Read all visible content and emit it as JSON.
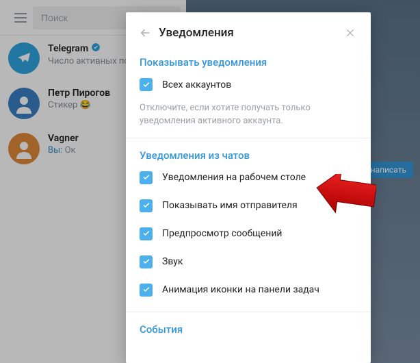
{
  "search": {
    "placeholder": "Поиск"
  },
  "chats": [
    {
      "name": "Telegram",
      "verified": true,
      "sub": "Число активных поль"
    },
    {
      "name": "Петр Пирогов",
      "sub_prefix": "Стикер",
      "emoji": "😂"
    },
    {
      "name": "Vagner",
      "you_label": "Вы:",
      "msg": "Ок"
    }
  ],
  "write_btn": "написать",
  "modal": {
    "title": "Уведомления",
    "section_show": "Показывать уведомления",
    "all_accounts": "Всех аккаунтов",
    "hint": "Отключите, если хотите получать только уведомления активного аккаунта.",
    "section_chats": "Уведомления из чатов",
    "opts": {
      "desktop": "Уведомления на рабочем столе",
      "sender": "Показывать имя отправителя",
      "preview": "Предпросмотр сообщений",
      "sound": "Звук",
      "taskbar": "Анимация иконки на панели задач"
    },
    "section_events": "События"
  }
}
